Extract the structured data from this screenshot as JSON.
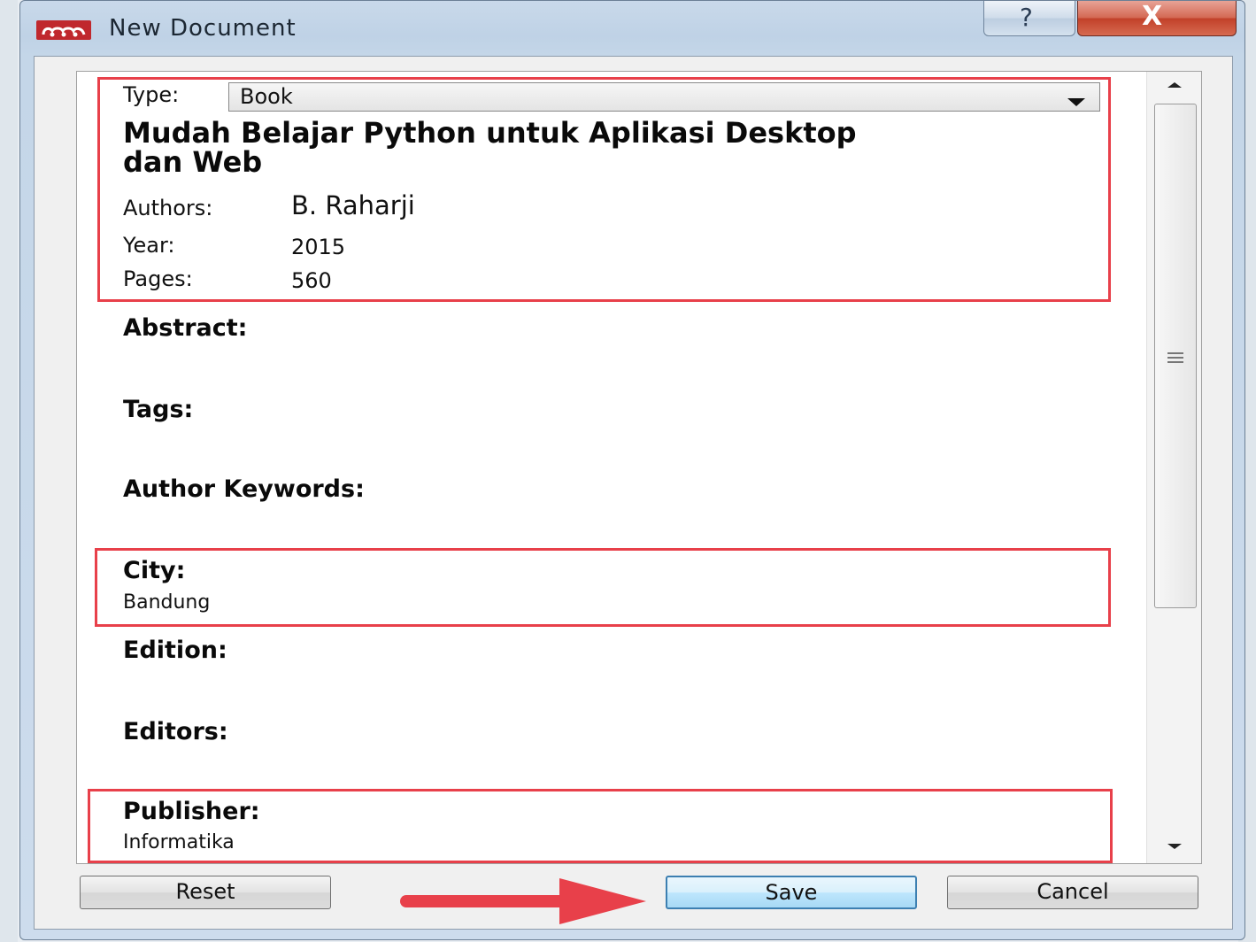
{
  "window": {
    "title": "New Document",
    "help_glyph": "?",
    "close_glyph": "X",
    "logo_icon": "mendeley-logo-icon"
  },
  "form": {
    "type_label": "Type:",
    "type_value": "Book",
    "title": "Mudah Belajar Python untuk Aplikasi Desktop dan Web",
    "authors_label": "Authors:",
    "authors_value": "B. Raharji",
    "year_label": "Year:",
    "year_value": "2015",
    "pages_label": "Pages:",
    "pages_value": "560",
    "abstract_label": "Abstract:",
    "tags_label": "Tags:",
    "keywords_label": "Author Keywords:",
    "city_label": "City:",
    "city_value": "Bandung",
    "edition_label": "Edition:",
    "editors_label": "Editors:",
    "publisher_label": "Publisher:",
    "publisher_value": "Informatika"
  },
  "buttons": {
    "reset": "Reset",
    "save": "Save",
    "cancel": "Cancel"
  },
  "colors": {
    "highlight": "#e8404a",
    "arrow": "#e8404a",
    "logo": "#c0282d"
  }
}
